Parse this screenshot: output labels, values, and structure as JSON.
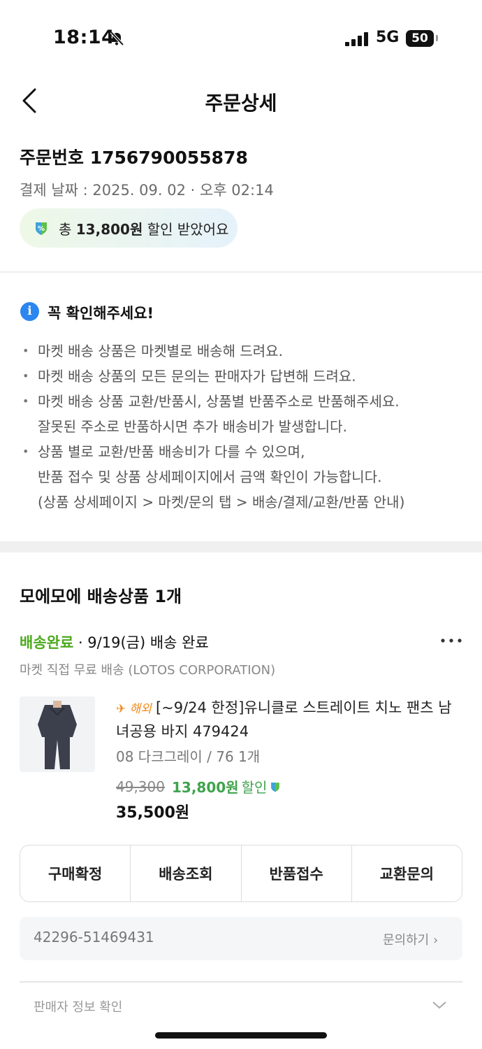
{
  "status_bar": {
    "time": "18:14",
    "network": "5G",
    "battery": "50"
  },
  "header": {
    "title": "주문상세"
  },
  "order": {
    "number_text": "주문번호 1756790055878",
    "payment_date_text": "결제 날짜 : 2025. 09. 02 · 오후 02:14",
    "discount_prefix": "총 ",
    "discount_amount": "13,800원",
    "discount_suffix": " 할인 받았어요"
  },
  "notice": {
    "title": "꼭 확인해주세요!",
    "items": [
      [
        "마켓 배송 상품은 마켓별로 배송해 드려요."
      ],
      [
        "마켓 배송 상품의 모든 문의는 판매자가 답변해 드려요."
      ],
      [
        "마켓 배송 상품 교환/반품시, 상품별 반품주소로 반품해주세요.",
        "잘못된 주소로 반품하시면 추가 배송비가 발생합니다."
      ],
      [
        "상품 별로 교환/반품 배송비가 다를 수 있으며,",
        "반품 접수 및 상품 상세페이지에서 금액 확인이 가능합니다.",
        "(상품 상세페이지 > 마켓/문의 탭 > 배송/결제/교환/반품 안내)"
      ]
    ]
  },
  "section": {
    "title": "모에모에 배송상품 1개",
    "status": "배송완료",
    "status_detail": " · 9/19(금) 배송 완료",
    "seller_line": "마켓 직접 무료 배송 (LOTOS CORPORATION)"
  },
  "product": {
    "overseas_label": "해외",
    "name": "[~9/24 한정]유니클로 스트레이트 치노 팬츠 남녀공용 바지 479424",
    "option": "08 다크그레이 / 76  1개",
    "original_price": "49,300",
    "discount": "13,800원",
    "discount_label": "할인",
    "final_price": "35,500원"
  },
  "actions": [
    "구매확정",
    "배송조회",
    "반품접수",
    "교환문의"
  ],
  "invoice": {
    "number": "42296-51469431",
    "inquiry": "문의하기"
  },
  "seller_info": "판매자 정보 확인",
  "colors": {
    "accent_green": "#4caa1e",
    "info_blue": "#2b86f0",
    "overseas_orange": "#f08a1c"
  }
}
